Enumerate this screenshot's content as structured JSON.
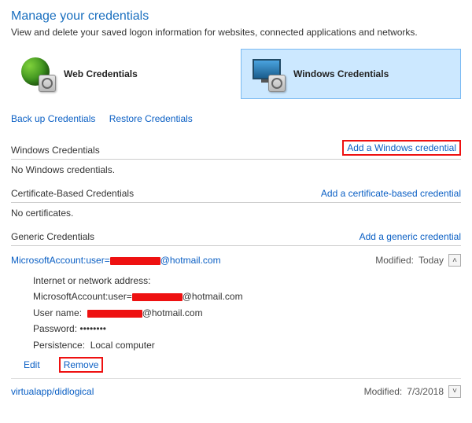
{
  "page": {
    "title": "Manage your credentials",
    "subtitle": "View and delete your saved logon information for websites, connected applications and networks."
  },
  "tabs": {
    "web": "Web Credentials",
    "windows": "Windows Credentials"
  },
  "links": {
    "backup": "Back up Credentials",
    "restore": "Restore Credentials"
  },
  "sections": {
    "windows": {
      "title": "Windows Credentials",
      "add": "Add a Windows credential",
      "empty": "No Windows credentials."
    },
    "cert": {
      "title": "Certificate-Based Credentials",
      "add": "Add a certificate-based credential",
      "empty": "No certificates."
    },
    "generic": {
      "title": "Generic Credentials",
      "add": "Add a generic credential"
    }
  },
  "labels": {
    "modified": "Modified:",
    "addr": "Internet or network address:",
    "user": "User name:",
    "pass": "Password:",
    "persist": "Persistence:",
    "edit": "Edit",
    "remove": "Remove"
  },
  "entries": [
    {
      "name_prefix": "MicrosoftAccount:user=",
      "name_suffix": "@hotmail.com",
      "modified": "Today",
      "expanded": true,
      "addr_prefix": "MicrosoftAccount:user=",
      "addr_suffix": "@hotmail.com",
      "user_suffix": "@hotmail.com",
      "pass_mask": "••••••••",
      "persistence": "Local computer"
    },
    {
      "name": "virtualapp/didlogical",
      "modified": "7/3/2018",
      "expanded": false
    }
  ]
}
